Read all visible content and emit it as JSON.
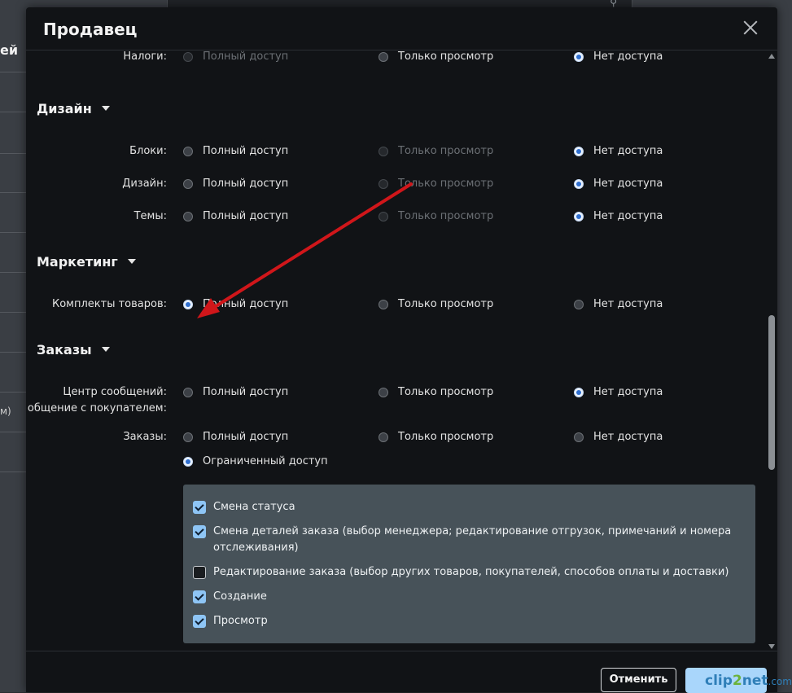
{
  "background": {
    "left_text_top": "ей",
    "left_text_mid": "м)"
  },
  "modal": {
    "title": "Продавец",
    "close_icon": "close-icon"
  },
  "rows": {
    "taxes": {
      "label": "Налоги:",
      "options": [
        "Полный доступ",
        "Только просмотр",
        "Нет доступа"
      ]
    },
    "blocks": {
      "label": "Блоки:",
      "options": [
        "Полный доступ",
        "Только просмотр",
        "Нет доступа"
      ]
    },
    "design": {
      "label": "Дизайн:",
      "options": [
        "Полный доступ",
        "Только просмотр",
        "Нет доступа"
      ]
    },
    "themes": {
      "label": "Темы:",
      "options": [
        "Полный доступ",
        "Только просмотр",
        "Нет доступа"
      ]
    },
    "bundles": {
      "label": "Комплекты товаров:",
      "options": [
        "Полный доступ",
        "Только просмотр",
        "Нет доступа"
      ]
    },
    "messages": {
      "label_line1": "Центр сообщений:",
      "label_line2": "общение с покупателем:",
      "options": [
        "Полный доступ",
        "Только просмотр",
        "Нет доступа"
      ]
    },
    "orders": {
      "label": "Заказы:",
      "options": [
        "Полный доступ",
        "Только просмотр",
        "Нет доступа"
      ],
      "limited": "Ограниченный доступ"
    }
  },
  "sections": {
    "design": "Дизайн",
    "marketing": "Маркетинг",
    "orders": "Заказы"
  },
  "order_permissions": [
    {
      "label": "Смена статуса",
      "checked": true
    },
    {
      "label": "Смена деталей заказа (выбор менеджера; редактирование отгрузок, примечаний и номера отслеживания)",
      "checked": true
    },
    {
      "label": "Редактирование заказа (выбор других товаров, покупателей, способов оплаты и доставки)",
      "checked": false
    },
    {
      "label": "Создание",
      "checked": true
    },
    {
      "label": "Просмотр",
      "checked": true
    }
  ],
  "footer": {
    "cancel_label": "Отменить"
  },
  "watermark": {
    "part1": "clip",
    "part2": "2",
    "part3": "net",
    "part4": ".com"
  },
  "colors": {
    "annotation_arrow": "#d0161a",
    "radio_selected": "#2f6fd0",
    "checkbox_checked": "#8ec5f5",
    "save_button": "#a9d6fb"
  }
}
